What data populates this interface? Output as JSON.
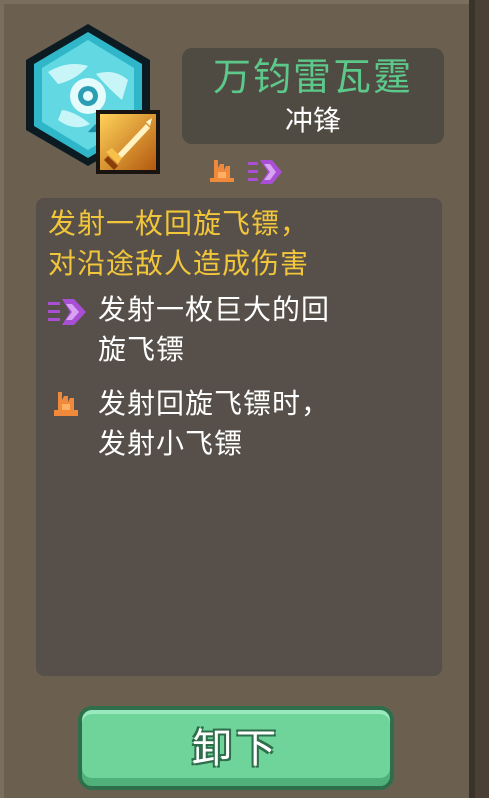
{
  "item": {
    "name": "万钧雷瓦霆",
    "type": "冲锋",
    "icon": "lightning-gem-icon",
    "badge_icon": "sword-slash-badge-icon"
  },
  "tags": [
    {
      "icon": "flame-icon",
      "color": "#f08a3a"
    },
    {
      "icon": "speed-arrow-icon",
      "color": "#a84fd6"
    }
  ],
  "description": {
    "main_line_1": "发射一枚回旋飞镖，",
    "main_line_2": "对沿途敌人造成伤害",
    "modifiers": [
      {
        "icon": "speed-arrow-icon",
        "line_1": "发射一枚巨大的回",
        "line_2": "旋飞镖"
      },
      {
        "icon": "flame-icon",
        "line_1": "发射回旋飞镖时，",
        "line_2": "发射小飞镖"
      }
    ]
  },
  "actions": {
    "unequip_label": "卸下"
  },
  "colors": {
    "name": "#5cc98a",
    "main_description": "#f2c63a",
    "modifier_text": "#ffffff",
    "button": "#6fd49a"
  }
}
